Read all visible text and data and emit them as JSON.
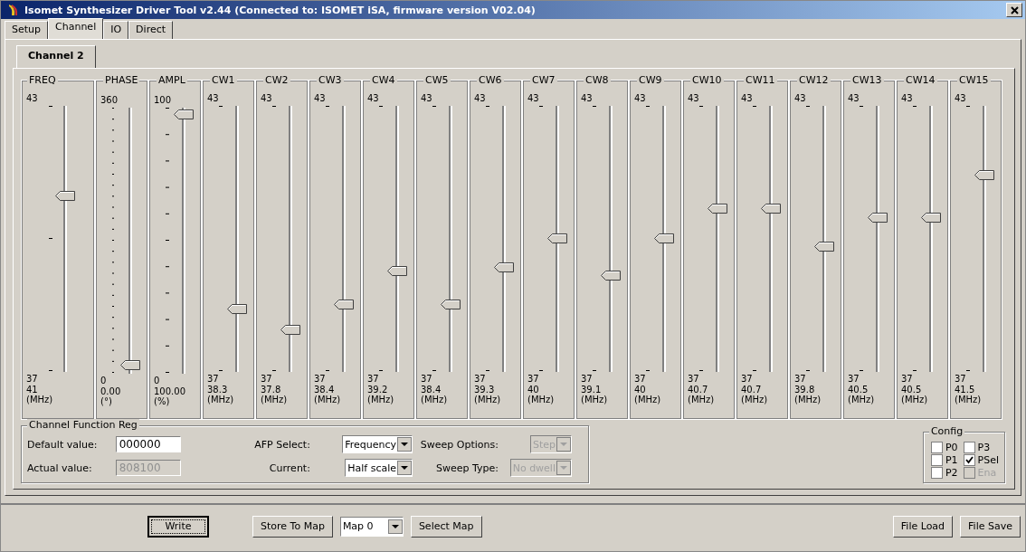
{
  "window": {
    "title": "Isomet Synthesizer Driver Tool v2.44 (Connected to: ISOMET iSA, firmware version V02.04)"
  },
  "tabs": [
    {
      "label": "Setup",
      "selected": false
    },
    {
      "label": "Channel",
      "selected": true
    },
    {
      "label": "IO",
      "selected": false
    },
    {
      "label": "Direct",
      "selected": false
    }
  ],
  "subtabs": [
    {
      "label": "Channel 2",
      "selected": true
    }
  ],
  "sliders": [
    {
      "kind": "freq",
      "label": "FREQ",
      "max": "43",
      "min": "37",
      "value": "41",
      "unit": "(MHz)",
      "level": 0.667
    },
    {
      "kind": "phase",
      "label": "PHASE",
      "max": "360",
      "min": "0",
      "value": "0.00",
      "unit": "(°)",
      "level": 0
    },
    {
      "kind": "ampl",
      "label": "AMPL",
      "max": "100",
      "min": "0",
      "value": "100.00",
      "unit": "(%)",
      "level": 1
    },
    {
      "kind": "cw",
      "label": "CW1",
      "max": "43",
      "min": "37",
      "value": "38.3",
      "unit": "(MHz)",
      "level": 0.217
    },
    {
      "kind": "cw",
      "label": "CW2",
      "max": "43",
      "min": "37",
      "value": "37.8",
      "unit": "(MHz)",
      "level": 0.133
    },
    {
      "kind": "cw",
      "label": "CW3",
      "max": "43",
      "min": "37",
      "value": "38.4",
      "unit": "(MHz)",
      "level": 0.233
    },
    {
      "kind": "cw",
      "label": "CW4",
      "max": "43",
      "min": "37",
      "value": "39.2",
      "unit": "(MHz)",
      "level": 0.367
    },
    {
      "kind": "cw",
      "label": "CW5",
      "max": "43",
      "min": "37",
      "value": "38.4",
      "unit": "(MHz)",
      "level": 0.233
    },
    {
      "kind": "cw",
      "label": "CW6",
      "max": "43",
      "min": "37",
      "value": "39.3",
      "unit": "(MHz)",
      "level": 0.383
    },
    {
      "kind": "cw",
      "label": "CW7",
      "max": "43",
      "min": "37",
      "value": "40",
      "unit": "(MHz)",
      "level": 0.5
    },
    {
      "kind": "cw",
      "label": "CW8",
      "max": "43",
      "min": "37",
      "value": "39.1",
      "unit": "(MHz)",
      "level": 0.35
    },
    {
      "kind": "cw",
      "label": "CW9",
      "max": "43",
      "min": "37",
      "value": "40",
      "unit": "(MHz)",
      "level": 0.5
    },
    {
      "kind": "cw",
      "label": "CW10",
      "max": "43",
      "min": "37",
      "value": "40.7",
      "unit": "(MHz)",
      "level": 0.617
    },
    {
      "kind": "cw",
      "label": "CW11",
      "max": "43",
      "min": "37",
      "value": "40.7",
      "unit": "(MHz)",
      "level": 0.617
    },
    {
      "kind": "cw",
      "label": "CW12",
      "max": "43",
      "min": "37",
      "value": "39.8",
      "unit": "(MHz)",
      "level": 0.467
    },
    {
      "kind": "cw",
      "label": "CW13",
      "max": "43",
      "min": "37",
      "value": "40.5",
      "unit": "(MHz)",
      "level": 0.583
    },
    {
      "kind": "cw",
      "label": "CW14",
      "max": "43",
      "min": "37",
      "value": "40.5",
      "unit": "(MHz)",
      "level": 0.583
    },
    {
      "kind": "cw",
      "label": "CW15",
      "max": "43",
      "min": "37",
      "value": "41.5",
      "unit": "(MHz)",
      "level": 0.75
    }
  ],
  "function_reg": {
    "title": "Channel Function Reg",
    "default_value": {
      "label": "Default value:",
      "value": "000000"
    },
    "actual_value": {
      "label": "Actual value:",
      "value": "808100",
      "disabled": true
    },
    "afp_select": {
      "label": "AFP Select:",
      "value": "Frequency",
      "disabled": false
    },
    "current": {
      "label": "Current:",
      "value": "Half scale",
      "disabled": false
    },
    "sweep_options": {
      "label": "Sweep Options:",
      "value": "Step",
      "disabled": true
    },
    "sweep_type": {
      "label": "Sweep Type:",
      "value": "No dwell",
      "disabled": true
    }
  },
  "config": {
    "title": "Config",
    "items": [
      {
        "label": "P0",
        "checked": false,
        "disabled": false
      },
      {
        "label": "P3",
        "checked": false,
        "disabled": false
      },
      {
        "label": "P1",
        "checked": false,
        "disabled": false
      },
      {
        "label": "PSel",
        "checked": true,
        "disabled": false
      },
      {
        "label": "P2",
        "checked": false,
        "disabled": false
      },
      {
        "label": "Ena",
        "checked": false,
        "disabled": true
      }
    ]
  },
  "buttons": {
    "write": "Write",
    "store": "Store To Map",
    "map": "Map 0",
    "select": "Select Map",
    "load": "File Load",
    "save": "File Save"
  }
}
